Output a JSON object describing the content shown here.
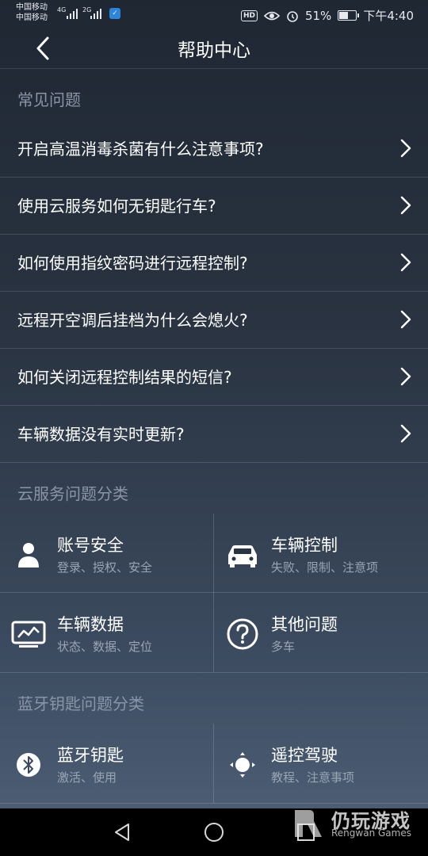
{
  "status_bar": {
    "carrier1": "中国移动",
    "carrier2": "中国移动",
    "net1": "4G",
    "net2": "2G",
    "hd": "HD",
    "battery": "51%",
    "time": "下午4:40"
  },
  "header": {
    "title": "帮助中心",
    "back_icon": "chevron-left"
  },
  "faq": {
    "label": "常见问题",
    "items": [
      "开启高温消毒杀菌有什么注意事项?",
      "使用云服务如何无钥匙行车?",
      "如何使用指纹密码进行远程控制?",
      "远程开空调后挂档为什么会熄火?",
      "如何关闭远程控制结果的短信?",
      "车辆数据没有实时更新?"
    ]
  },
  "cloud": {
    "label": "云服务问题分类",
    "items": [
      {
        "title": "账号安全",
        "sub": "登录、授权、安全",
        "icon": "user-icon"
      },
      {
        "title": "车辆控制",
        "sub": "失败、限制、注意项",
        "icon": "car-icon"
      },
      {
        "title": "车辆数据",
        "sub": "状态、数据、定位",
        "icon": "monitor-chart-icon"
      },
      {
        "title": "其他问题",
        "sub": "多车",
        "icon": "question-icon"
      }
    ]
  },
  "bluetooth": {
    "label": "蓝牙钥匙问题分类",
    "items": [
      {
        "title": "蓝牙钥匙",
        "sub": "激活、使用",
        "icon": "bluetooth-icon"
      },
      {
        "title": "遥控驾驶",
        "sub": "教程、注意事项",
        "icon": "remote-drive-icon"
      }
    ]
  },
  "watermark": {
    "zh": "仍玩游戏",
    "en": "Rengwan Games"
  }
}
